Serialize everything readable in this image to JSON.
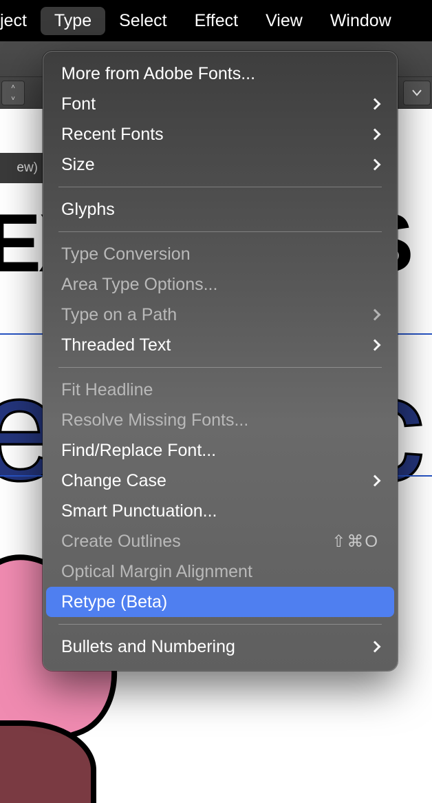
{
  "menubar": {
    "items": [
      {
        "label": "ject"
      },
      {
        "label": "Type"
      },
      {
        "label": "Select"
      },
      {
        "label": "Effect"
      },
      {
        "label": "View"
      },
      {
        "label": "Window"
      }
    ],
    "active_index": 1
  },
  "tab_fragment": "ew)",
  "canvas": {
    "text1_left": "EX",
    "text1_right": "S",
    "text2_left": "e",
    "text2_right": "c"
  },
  "dropdown": {
    "groups": [
      [
        {
          "label": "More from Adobe Fonts...",
          "submenu": false,
          "enabled": true
        },
        {
          "label": "Font",
          "submenu": true,
          "enabled": true
        },
        {
          "label": "Recent Fonts",
          "submenu": true,
          "enabled": true
        },
        {
          "label": "Size",
          "submenu": true,
          "enabled": true
        }
      ],
      [
        {
          "label": "Glyphs",
          "submenu": false,
          "enabled": true
        }
      ],
      [
        {
          "label": "Type Conversion",
          "submenu": false,
          "enabled": false
        },
        {
          "label": "Area Type Options...",
          "submenu": false,
          "enabled": false
        },
        {
          "label": "Type on a Path",
          "submenu": true,
          "enabled": false
        },
        {
          "label": "Threaded Text",
          "submenu": true,
          "enabled": true
        }
      ],
      [
        {
          "label": "Fit Headline",
          "submenu": false,
          "enabled": false
        },
        {
          "label": "Resolve Missing Fonts...",
          "submenu": false,
          "enabled": false
        },
        {
          "label": "Find/Replace Font...",
          "submenu": false,
          "enabled": true
        },
        {
          "label": "Change Case",
          "submenu": true,
          "enabled": true
        },
        {
          "label": "Smart Punctuation...",
          "submenu": false,
          "enabled": true
        },
        {
          "label": "Create Outlines",
          "submenu": false,
          "enabled": false,
          "shortcut": "⇧⌘O"
        },
        {
          "label": "Optical Margin Alignment",
          "submenu": false,
          "enabled": false
        },
        {
          "label": "Retype (Beta)",
          "submenu": false,
          "enabled": true,
          "highlight": true
        }
      ],
      [
        {
          "label": "Bullets and Numbering",
          "submenu": true,
          "enabled": true
        }
      ]
    ]
  }
}
